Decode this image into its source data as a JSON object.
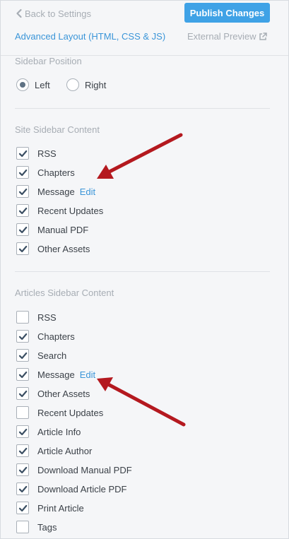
{
  "header": {
    "back_label": "Back to Settings",
    "publish_label": "Publish Changes",
    "advanced_label": "Advanced Layout (HTML, CSS & JS)",
    "external_label": "External Preview"
  },
  "sidebar_position": {
    "title": "Sidebar Position",
    "options": [
      {
        "label": "Left",
        "selected": true
      },
      {
        "label": "Right",
        "selected": false
      }
    ]
  },
  "site_sidebar": {
    "title": "Site Sidebar Content",
    "items": [
      {
        "label": "RSS",
        "checked": true,
        "edit": ""
      },
      {
        "label": "Chapters",
        "checked": true,
        "edit": ""
      },
      {
        "label": "Message",
        "checked": true,
        "edit": "Edit"
      },
      {
        "label": "Recent Updates",
        "checked": true,
        "edit": ""
      },
      {
        "label": "Manual PDF",
        "checked": true,
        "edit": ""
      },
      {
        "label": "Other Assets",
        "checked": true,
        "edit": ""
      }
    ]
  },
  "articles_sidebar": {
    "title": "Articles Sidebar Content",
    "items": [
      {
        "label": "RSS",
        "checked": false,
        "edit": ""
      },
      {
        "label": "Chapters",
        "checked": true,
        "edit": ""
      },
      {
        "label": "Search",
        "checked": true,
        "edit": ""
      },
      {
        "label": "Message",
        "checked": true,
        "edit": "Edit"
      },
      {
        "label": "Other Assets",
        "checked": true,
        "edit": ""
      },
      {
        "label": "Recent Updates",
        "checked": false,
        "edit": ""
      },
      {
        "label": "Article Info",
        "checked": true,
        "edit": ""
      },
      {
        "label": "Article Author",
        "checked": true,
        "edit": ""
      },
      {
        "label": "Download Manual PDF",
        "checked": true,
        "edit": ""
      },
      {
        "label": "Download Article PDF",
        "checked": true,
        "edit": ""
      },
      {
        "label": "Print Article",
        "checked": true,
        "edit": ""
      },
      {
        "label": "Tags",
        "checked": false,
        "edit": ""
      }
    ]
  },
  "colors": {
    "accent": "#3fa2e6",
    "link": "#3a95d8",
    "annotation_arrow": "#b4191f",
    "check": "#3b4f63"
  }
}
